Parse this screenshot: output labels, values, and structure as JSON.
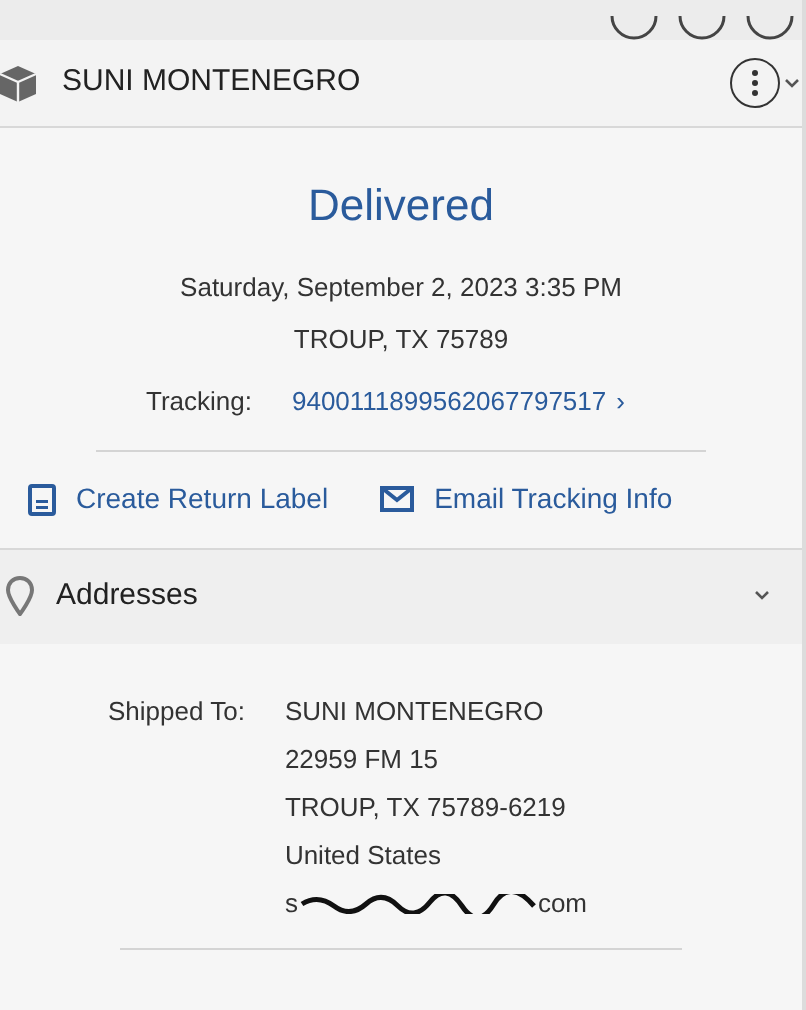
{
  "header": {
    "title": "SUNI MONTENEGRO"
  },
  "status": {
    "label": "Delivered",
    "date": "Saturday, September 2, 2023 3:35 PM",
    "location": "TROUP, TX 75789"
  },
  "tracking": {
    "label": "Tracking:",
    "number": "9400111899562067797517",
    "chevron": "›"
  },
  "actions": [
    {
      "kind": "label",
      "label": "Create Return Label"
    },
    {
      "kind": "email",
      "label": "Email Tracking Info"
    }
  ],
  "addresses": {
    "title": "Addresses",
    "expanded": true,
    "shipped_to_label": "Shipped To:",
    "lines": [
      "SUNI MONTENEGRO",
      "22959 FM 15",
      "TROUP, TX 75789-6219",
      "United States"
    ],
    "email_start": "s",
    "email_end": "com"
  }
}
